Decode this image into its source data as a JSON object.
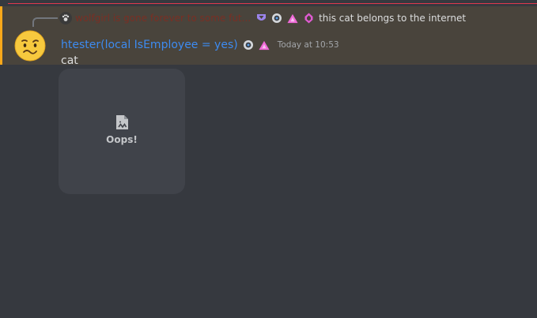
{
  "reply": {
    "author": "wolfgirl is gone forever to some fut...",
    "author_color": "#7a2f24",
    "badges": [
      "nitro-badge",
      "hypesquad-badge",
      "triangle-badge",
      "gem-badge"
    ],
    "text": "this cat belongs to the internet"
  },
  "message": {
    "author": "htester(local IsEmployee = yes)",
    "author_color": "#3d8bf0",
    "badges": [
      "hypesquad-badge",
      "triangle-badge"
    ],
    "timestamp": "Today at 10:53",
    "content": "cat",
    "highlight_color": "#faa81a"
  },
  "attachment": {
    "icon": "broken-file-icon",
    "label": "Oops!"
  }
}
